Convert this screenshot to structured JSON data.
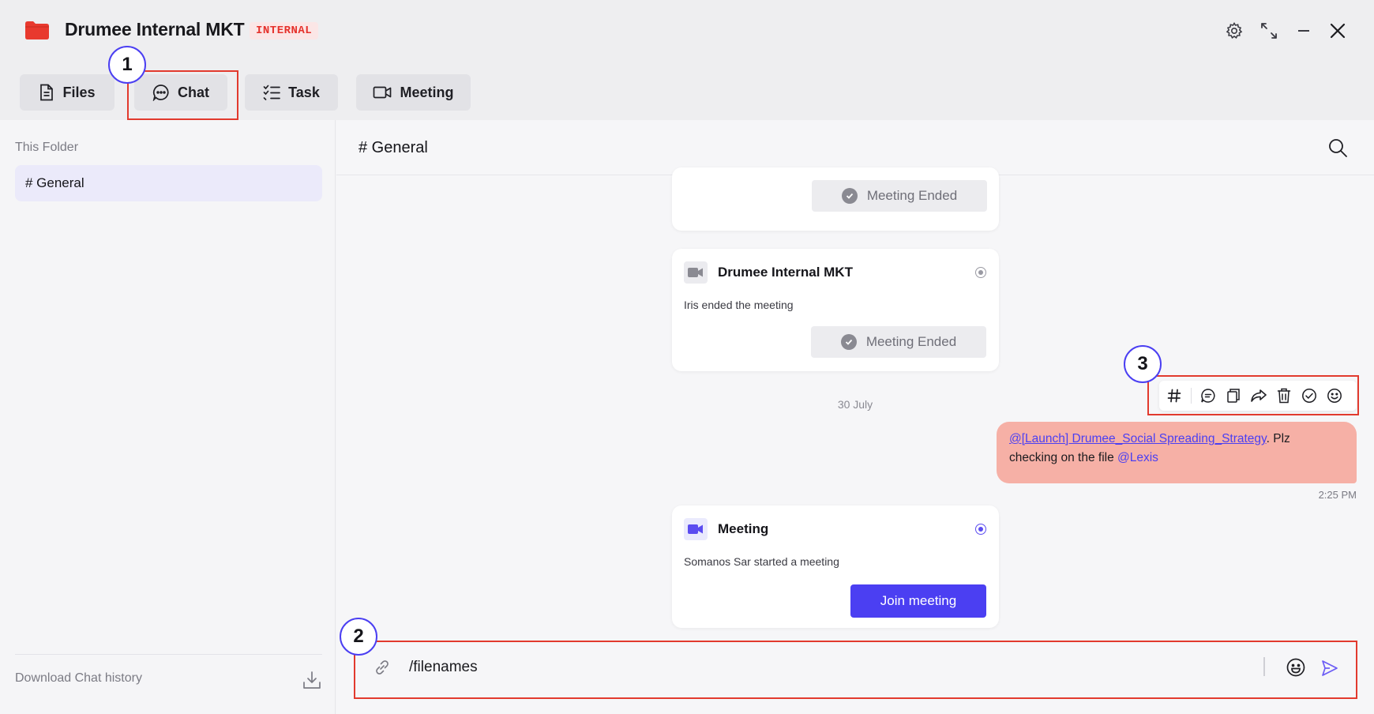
{
  "window": {
    "title": "Drumee Internal MKT",
    "badge": "INTERNAL",
    "folder_icon": "folder-icon",
    "controls": [
      "gear-icon",
      "expand-icon",
      "minimize-icon",
      "close-icon"
    ]
  },
  "tabs": [
    {
      "label": "Files",
      "icon": "file-icon"
    },
    {
      "label": "Chat",
      "icon": "chat-icon"
    },
    {
      "label": "Task",
      "icon": "checklist-icon"
    },
    {
      "label": "Meeting",
      "icon": "video-icon"
    }
  ],
  "sidebar": {
    "heading": "This Folder",
    "items": [
      {
        "label": "# General"
      }
    ],
    "download_label": "Download Chat history"
  },
  "channel": {
    "title": "# General"
  },
  "messages": {
    "card_top": {
      "ended_label": "Meeting Ended"
    },
    "card_mid": {
      "title": "Drumee Internal MKT",
      "text": "Iris ended the meeting",
      "ended_label": "Meeting Ended"
    },
    "date_separator": "30 July",
    "bubble": {
      "link": "@[Launch] Drumee_Social Spreading_Strategy",
      "text_after_link": ". Plz",
      "text_line2": "checking on the file ",
      "mention": "@Lexis",
      "time": "2:25 PM"
    },
    "card_bottom": {
      "title": "Meeting",
      "text": "Somanos Sar started a meeting",
      "button": "Join meeting"
    }
  },
  "message_toolbar": [
    "hash-icon",
    "reply-icon",
    "copy-icon",
    "forward-icon",
    "trash-icon",
    "check-icon",
    "emoji-icon"
  ],
  "composer": {
    "value": "/filenames"
  },
  "annotations": [
    "1",
    "2",
    "3"
  ],
  "colors": {
    "accent": "#4b3ff2",
    "badge_red": "#e5312b",
    "bubble": "#f6b0a6",
    "annotation_red": "#e23a2e"
  }
}
